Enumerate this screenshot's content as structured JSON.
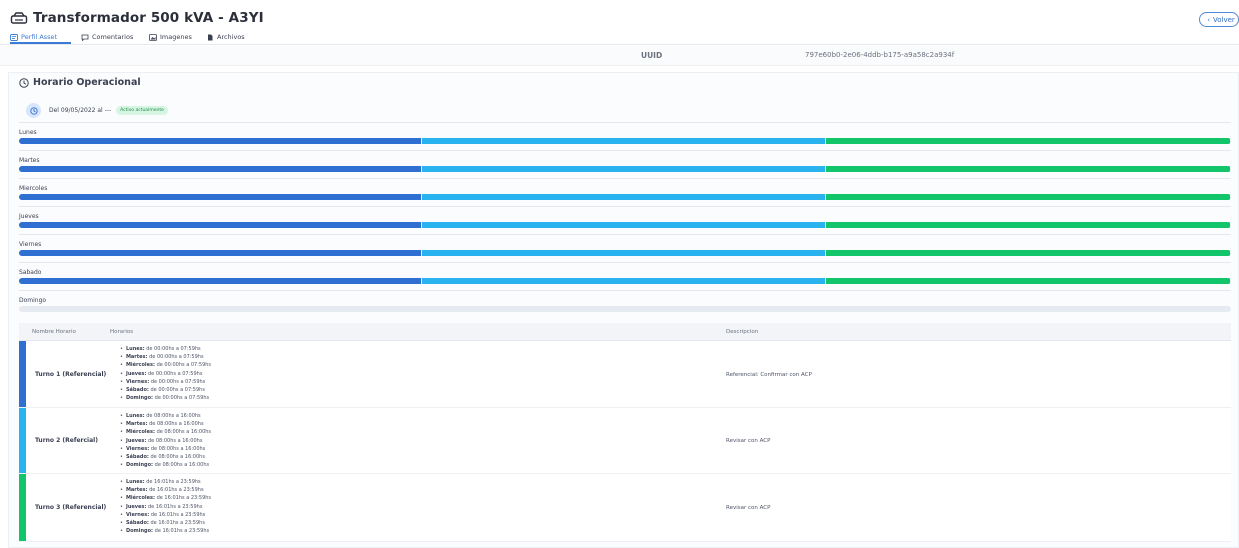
{
  "header": {
    "title": "Transformador 500 kVA - A3YI",
    "back_label": "Volver"
  },
  "tabs": [
    {
      "label": "Perfil Asset",
      "icon": "id-card-icon",
      "active": true
    },
    {
      "label": "Comentarios",
      "icon": "comment-icon",
      "active": false
    },
    {
      "label": "Imagenes",
      "icon": "image-icon",
      "active": false
    },
    {
      "label": "Archivos",
      "icon": "file-icon",
      "active": false
    }
  ],
  "uuid": {
    "label": "UUID",
    "value": "797e60b0-2e06-4ddb-b175-a9a58c2a934f"
  },
  "operational": {
    "title": "Horario Operacional",
    "period": "Del 09/05/2022 al ---",
    "badge": "Activo actualmente",
    "shift_colors": [
      "#2f6fd1",
      "#29b3ee",
      "#12c46a"
    ],
    "days": [
      {
        "name": "Lunes",
        "shifts": [
          1,
          2,
          3
        ]
      },
      {
        "name": "Martes",
        "shifts": [
          1,
          2,
          3
        ]
      },
      {
        "name": "Miercoles",
        "shifts": [
          1,
          2,
          3
        ]
      },
      {
        "name": "Jueves",
        "shifts": [
          1,
          2,
          3
        ]
      },
      {
        "name": "Viernes",
        "shifts": [
          1,
          2,
          3
        ]
      },
      {
        "name": "Sabado",
        "shifts": [
          1,
          2,
          3
        ]
      },
      {
        "name": "Domingo",
        "shifts": []
      }
    ]
  },
  "table": {
    "headers": {
      "name": "Nombre Horario",
      "schedule": "Horarios",
      "description": "Descripcion"
    },
    "rows": [
      {
        "name": "Turno 1 (Referencial)",
        "description": "Referencial: Confirmar con ACP",
        "color": "#2f6fd1",
        "schedule": [
          {
            "day": "Lunes:",
            "time": "de 00:00hs a 07:59hs"
          },
          {
            "day": "Martes:",
            "time": "de 00:00hs a 07:59hs"
          },
          {
            "day": "Miércoles:",
            "time": "de 00:00hs a 07:59hs"
          },
          {
            "day": "Jueves:",
            "time": "de 00:00hs a 07:59hs"
          },
          {
            "day": "Viernes:",
            "time": "de 00:00hs a 07:59hs"
          },
          {
            "day": "Sábado:",
            "time": "de 00:00hs a 07:59hs"
          },
          {
            "day": "Domingo:",
            "time": "de 00:00hs a 07:59hs"
          }
        ]
      },
      {
        "name": "Turno 2 (Refercial)",
        "description": "Revisar con ACP",
        "color": "#29b3ee",
        "schedule": [
          {
            "day": "Lunes:",
            "time": "de 08:00hs a 16:00hs"
          },
          {
            "day": "Martes:",
            "time": "de 08:00hs a 16:00hs"
          },
          {
            "day": "Miércoles:",
            "time": "de 08:00hs a 16:00hs"
          },
          {
            "day": "Jueves:",
            "time": "de 08:00hs a 16:00hs"
          },
          {
            "day": "Viernes:",
            "time": "de 08:00hs a 16:00hs"
          },
          {
            "day": "Sábado:",
            "time": "de 08:00hs a 16:00hs"
          },
          {
            "day": "Domingo:",
            "time": "de 08:00hs a 16:00hs"
          }
        ]
      },
      {
        "name": "Turno 3 (Referencial)",
        "description": "Revisar con ACP",
        "color": "#12c46a",
        "schedule": [
          {
            "day": "Lunes:",
            "time": "de 16:01hs a 23:59hs"
          },
          {
            "day": "Martes:",
            "time": "de 16:01hs a 23:59hs"
          },
          {
            "day": "Miércoles:",
            "time": "de 16:01hs a 23:59hs"
          },
          {
            "day": "Jueves:",
            "time": "de 16:01hs a 23:59hs"
          },
          {
            "day": "Viernes:",
            "time": "de 16:01hs a 23:59hs"
          },
          {
            "day": "Sábado:",
            "time": "de 16:01hs a 23:59hs"
          },
          {
            "day": "Domingo:",
            "time": "de 16:01hs a 23:59hs"
          }
        ]
      }
    ]
  }
}
